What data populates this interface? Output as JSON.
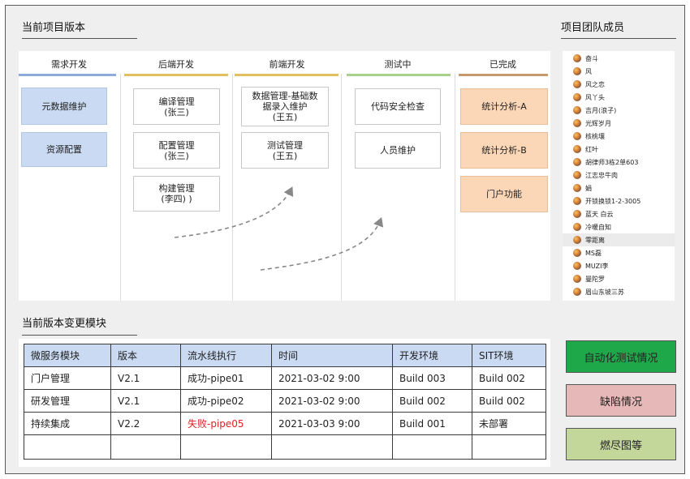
{
  "board_section": {
    "title": "当前项目版本"
  },
  "team_section": {
    "title": "项目团队成员"
  },
  "changes_section": {
    "title": "当前版本变更模块"
  },
  "columns": [
    {
      "label": "需求开发",
      "color": "#8eaadb"
    },
    {
      "label": "后端开发",
      "color": "#e0c060"
    },
    {
      "label": "前端开发",
      "color": "#e0c060"
    },
    {
      "label": "测试中",
      "color": "#a9d18e"
    },
    {
      "label": "已完成",
      "color": "#c59a6d"
    }
  ],
  "cards": {
    "req_1": "元数据维护",
    "req_2": "资源配置",
    "be_1": "编译管理\n(张三)",
    "be_2": "配置管理\n(张三)",
    "be_3": "构建管理\n(李四) )",
    "fe_1": "数据管理-基础数\n据录入维护\n(王五)",
    "fe_2": "测试管理\n(王五)",
    "test_1": "代码安全检查",
    "test_2": "人员维护",
    "done_1": "统计分析-A",
    "done_2": "统计分析-B",
    "done_3": "门户功能"
  },
  "members": [
    "奋斗",
    "风",
    "风之恋",
    "风丫头",
    "吉月(浪子)",
    "光辉岁月",
    "核桃壤",
    "红叶",
    "胡律师3栋2单603",
    "江志忠牛肉",
    "娟",
    "开锁换锁1-2-3005",
    "蓝天 白云",
    "冷暖自知",
    "零距离",
    "MS磊",
    "MUZI李",
    "曼陀罗",
    "眉山东坡三苏"
  ],
  "table": {
    "headers": [
      "微服务模块",
      "版本",
      "流水线执行",
      "时间",
      "开发环境",
      "SIT环境"
    ],
    "rows": [
      [
        "门户管理",
        "V2.1",
        "成功-pipe01",
        "2021-03-02 9:00",
        "Build 003",
        "Build 002"
      ],
      [
        "研发管理",
        "V2.1",
        "成功-pipe02",
        "2021-03-02 9:00",
        "Build 002",
        "Build 002"
      ],
      [
        "持续集成",
        "V2.2",
        "失败-pipe05",
        "2021-03-03 9:00",
        "Build 001",
        "未部署"
      ],
      [
        "",
        "",
        "",
        "",
        "",
        ""
      ]
    ],
    "fail_color": "#e02020"
  },
  "buttons": {
    "autotest": "自动化测试情况",
    "defects": "缺陷情况",
    "burndown": "燃尽图等"
  },
  "colors": {
    "autotest_bg": "#1fa84a",
    "defects_bg": "#e6b8b7",
    "burndown_bg": "#c4d79b"
  }
}
